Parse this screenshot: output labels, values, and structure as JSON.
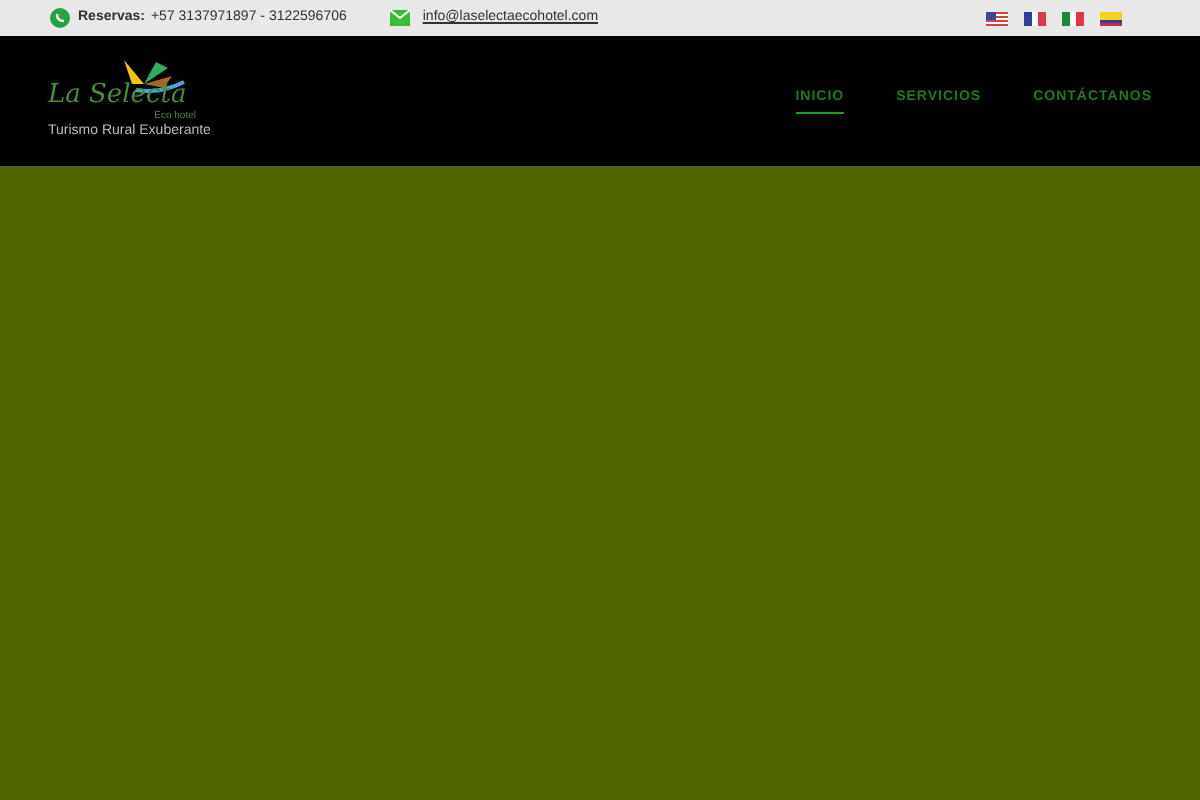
{
  "top_bar": {
    "reservations_label": "Reservas:",
    "phones": "+57 3137971897 - 3122596706",
    "email": "info@laselectaecohotel.com"
  },
  "logo": {
    "name": "La Selecta",
    "subtitle": "Eco hotel",
    "tagline": "Turismo Rural Exuberante"
  },
  "nav": [
    {
      "label": "INICIO",
      "selected": true
    },
    {
      "label": "SERVICIOS",
      "selected": false
    },
    {
      "label": "CONTÁCTANOS",
      "selected": false
    }
  ]
}
